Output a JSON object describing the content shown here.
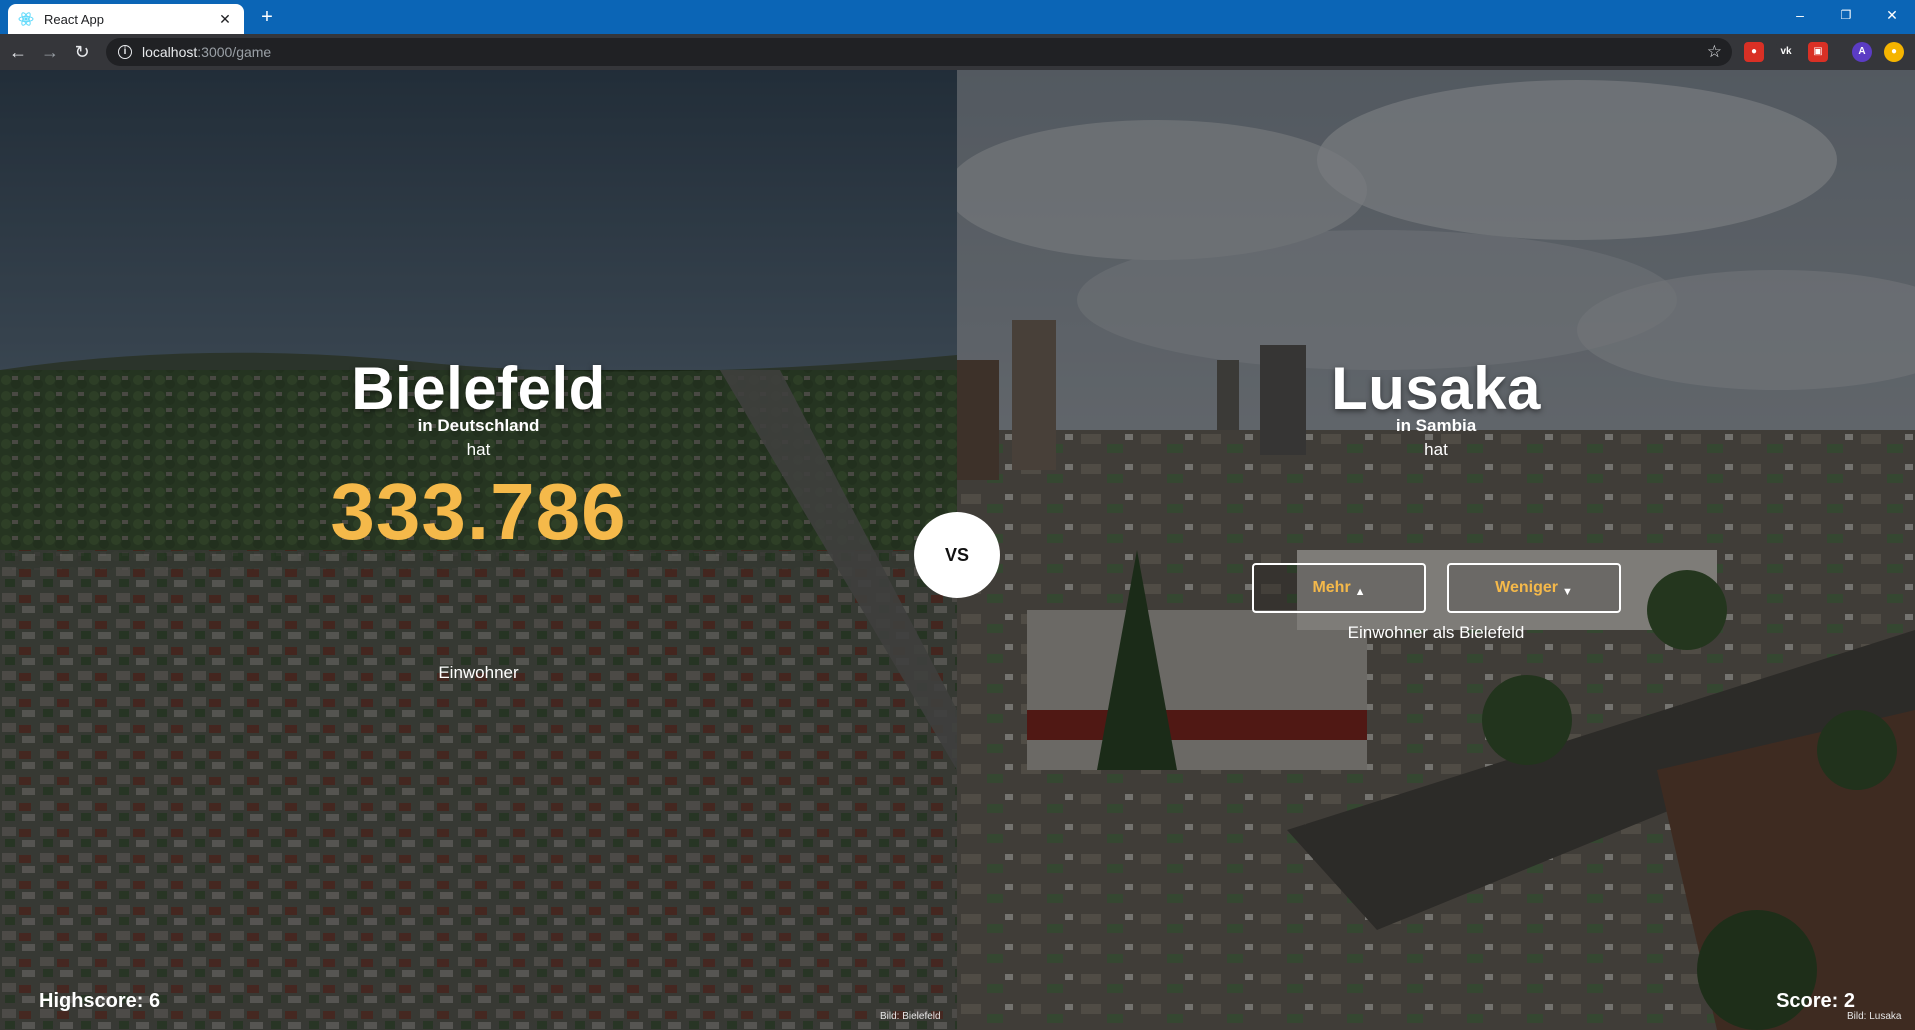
{
  "browser": {
    "tab_title": "React App",
    "tab_close": "✕",
    "new_tab": "+",
    "url_host": "localhost",
    "url_path": ":3000/game",
    "window_controls": {
      "minimize": "–",
      "restore": "❐",
      "close": "✕"
    },
    "extensions": [
      {
        "name": "adblock-extension-icon",
        "color": "#d93025",
        "glyph": "●"
      },
      {
        "name": "vk-extension-icon",
        "color": "#35363a",
        "glyph": "vk"
      },
      {
        "name": "screenshot-extension-icon",
        "color": "#d93025",
        "glyph": "▣"
      },
      {
        "name": "profile-avatar",
        "color": "#5b3cc4",
        "glyph": "A"
      },
      {
        "name": "coin-extension-icon",
        "color": "#f5b400",
        "glyph": "●"
      }
    ]
  },
  "game": {
    "left": {
      "city": "Bielefeld",
      "country": "in Deutschland",
      "has": "hat",
      "population": "333.786",
      "unit": "Einwohner",
      "credit": "Bild: Bielefeld"
    },
    "right": {
      "city": "Lusaka",
      "country": "in Sambia",
      "has": "hat",
      "more_label": "Mehr",
      "less_label": "Weniger",
      "compare_text": "Einwohner als Bielefeld",
      "credit": "Bild: Lusaka"
    },
    "vs": "VS",
    "highscore": "Highscore: 6",
    "score": "Score: 2"
  },
  "colors": {
    "accent": "#f5b94a",
    "tabbar": "#0b65b6",
    "toolbar": "#35363a"
  }
}
